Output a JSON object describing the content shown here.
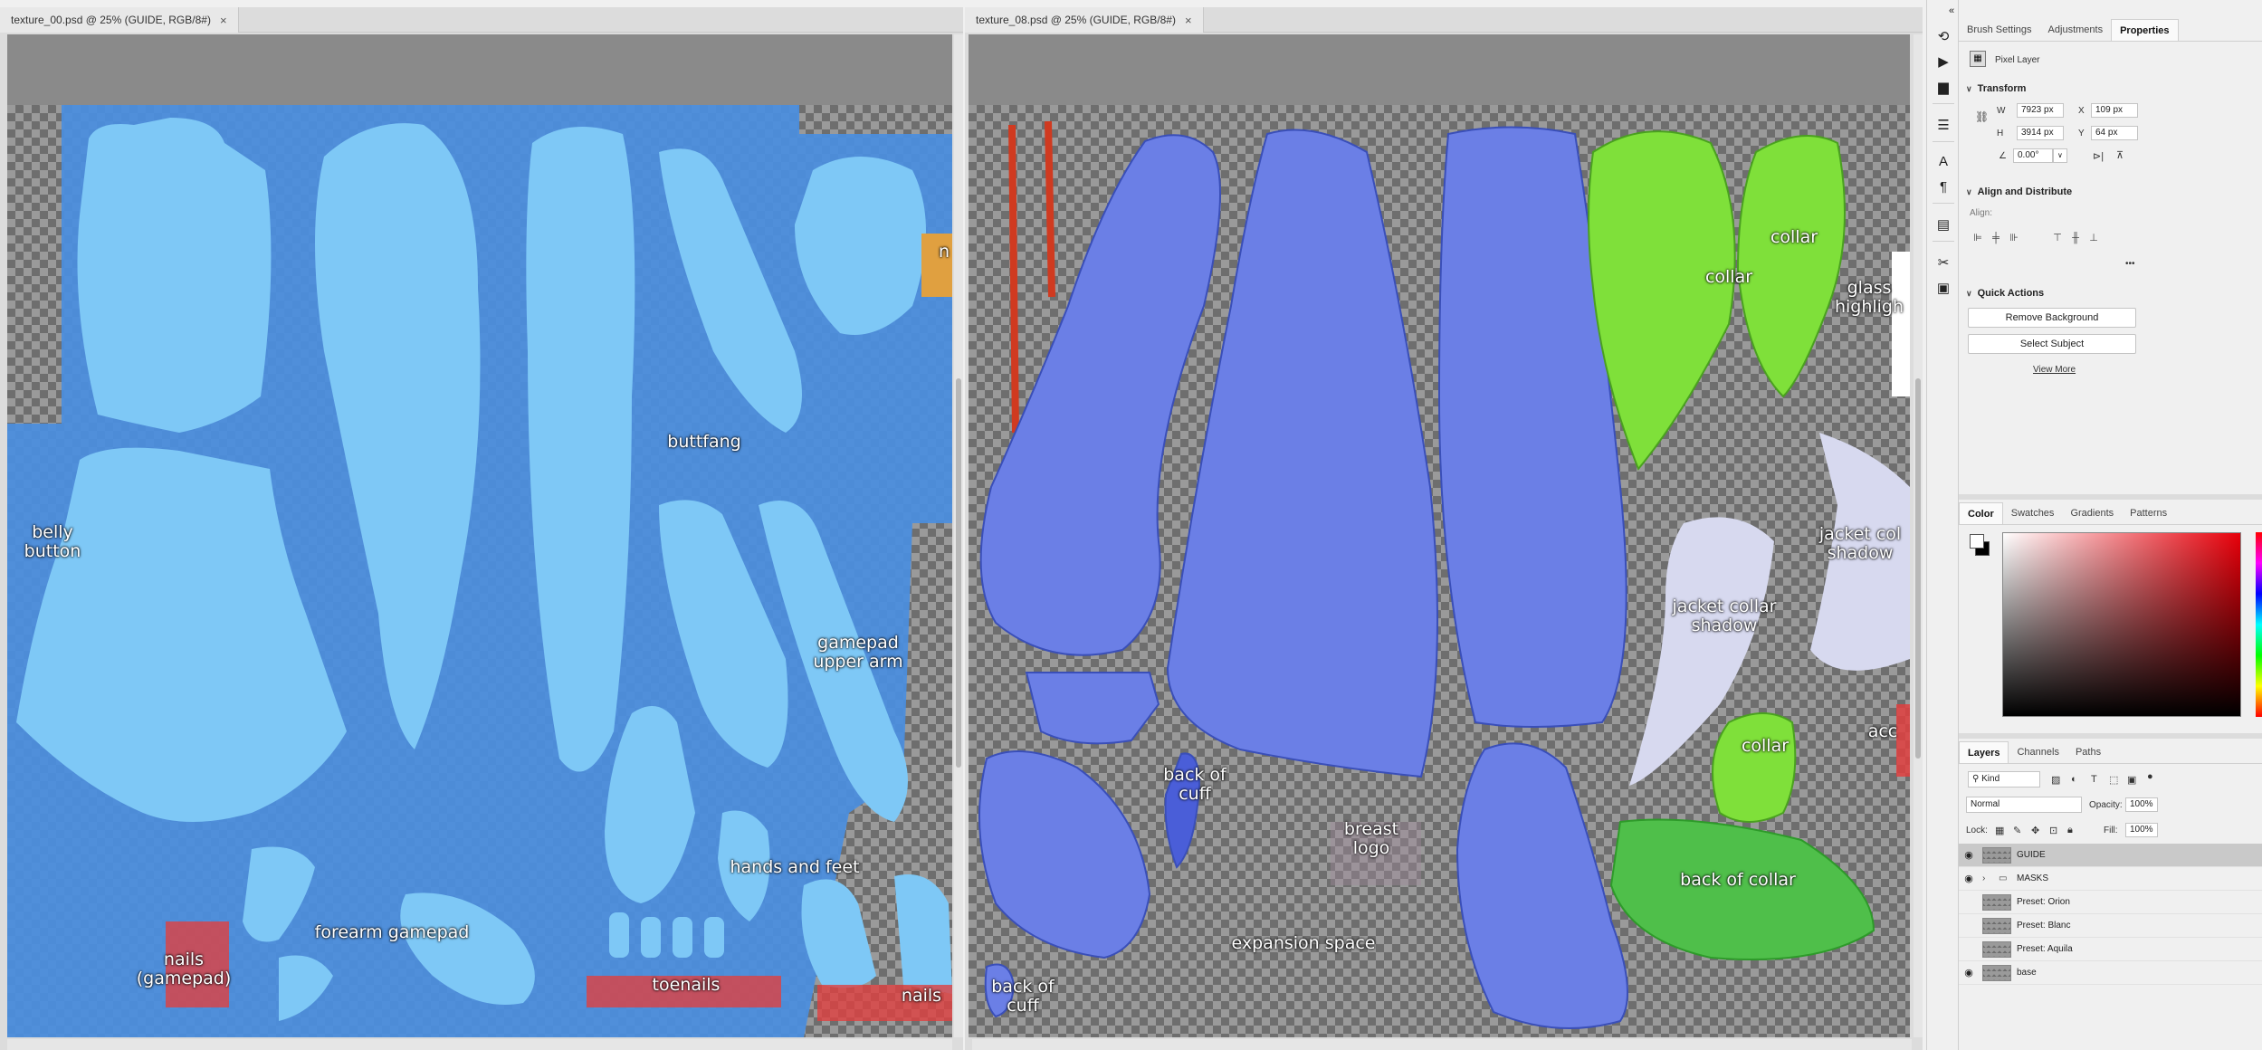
{
  "documents": [
    {
      "tab_title": "texture_00.psd @ 25% (GUIDE, RGB/8#)",
      "labels": [
        "belly\nbutton",
        "buttfang",
        "gamepad\nupper arm",
        "forearm gamepad",
        "hands and feet",
        "nails\n(gamepad)",
        "toenails",
        "nails",
        "n"
      ]
    },
    {
      "tab_title": "texture_08.psd @ 25% (GUIDE, RGB/8#)",
      "labels": [
        "collar",
        "collar",
        "glass\nhighligh",
        "jacket collar\nshadow",
        "jacket col\nshadow",
        "collar",
        "acc",
        "back of collar",
        "back of\ncuff",
        "breast\nlogo",
        "expansion space",
        "back of\ncuff"
      ]
    }
  ],
  "toolstrip": {
    "collapse_glyph": "«",
    "icons": [
      "history-icon",
      "play-icon",
      "comment-icon",
      "adjust-icon",
      "character-icon",
      "paragraph-icon",
      "libraries-icon",
      "tools-icon",
      "styles-icon"
    ]
  },
  "properties_panel": {
    "tabs": [
      "Brush Settings",
      "Adjustments",
      "Properties"
    ],
    "active_tab": "Properties",
    "layer_kind": "Pixel Layer",
    "transform": {
      "title": "Transform",
      "w_label": "W",
      "w_value": "7923 px",
      "h_label": "H",
      "h_value": "3914 px",
      "x_label": "X",
      "x_value": "109 px",
      "y_label": "Y",
      "y_value": "64 px",
      "angle_value": "0.00°"
    },
    "align": {
      "title": "Align and Distribute",
      "label": "Align:",
      "more": "•••"
    },
    "quick_actions": {
      "title": "Quick Actions",
      "remove_bg": "Remove Background",
      "select_subject": "Select Subject",
      "view_more": "View More"
    }
  },
  "color_panel": {
    "tabs": [
      "Color",
      "Swatches",
      "Gradients",
      "Patterns"
    ],
    "active_tab": "Color",
    "foreground": "#ffffff",
    "background": "#000000",
    "hue_color": "#e8000a"
  },
  "layers_panel": {
    "tabs": [
      "Layers",
      "Channels",
      "Paths"
    ],
    "active_tab": "Layers",
    "filter_kind": "Kind",
    "blend_mode": "Normal",
    "opacity_label": "Opacity:",
    "opacity_value": "100%",
    "lock_label": "Lock:",
    "fill_label": "Fill:",
    "fill_value": "100%",
    "layers": [
      {
        "name": "GUIDE",
        "visible": true,
        "selected": true,
        "folder": false
      },
      {
        "name": "MASKS",
        "visible": true,
        "selected": false,
        "folder": true
      },
      {
        "name": "Preset: Orion",
        "visible": false,
        "selected": false,
        "folder": false
      },
      {
        "name": "Preset: Blanc",
        "visible": false,
        "selected": false,
        "folder": false
      },
      {
        "name": "Preset: Aquila",
        "visible": false,
        "selected": false,
        "folder": false
      },
      {
        "name": "base",
        "visible": true,
        "selected": false,
        "folder": false
      }
    ]
  },
  "colors": {
    "uv_light_blue": "#7ec8f6",
    "uv_mask_blue": "#4a8ee0",
    "uv_jacket_blue": "#6b7fe6",
    "uv_green": "#7fe03a",
    "uv_dark_green": "#4fbf4a",
    "uv_lavender": "#d7d9ef",
    "uv_red": "#e04040",
    "uv_orange": "#e0a040"
  }
}
